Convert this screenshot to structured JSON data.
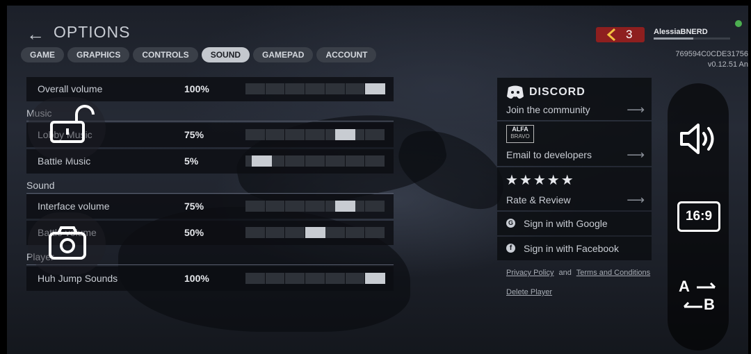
{
  "header": {
    "back_icon": "←",
    "title": "OPTIONS"
  },
  "tabs": [
    {
      "label": "GAME",
      "active": false
    },
    {
      "label": "GRAPHICS",
      "active": false
    },
    {
      "label": "CONTROLS",
      "active": false
    },
    {
      "label": "SOUND",
      "active": true
    },
    {
      "label": "GAMEPAD",
      "active": false
    },
    {
      "label": "ACCOUNT",
      "active": false
    }
  ],
  "settings": {
    "overall": {
      "label": "Overall volume",
      "value": "100%",
      "level": 1.0
    },
    "music_section": "Music",
    "lobby": {
      "label": "Lobby Music",
      "value": "75%",
      "level": 0.75
    },
    "battle_music": {
      "label": "Battle Music",
      "value": "5%",
      "level": 0.05
    },
    "sound_section": "Sound",
    "interface": {
      "label": "Interface volume",
      "value": "75%",
      "level": 0.75
    },
    "battle_volume": {
      "label": "Battle volume",
      "value": "50%",
      "level": 0.5
    },
    "player_section": "Player",
    "huh": {
      "label": "Huh Jump Sounds",
      "value": "100%",
      "level": 1.0
    }
  },
  "player": {
    "badge_number": "3",
    "name": "AlessiaBNERD",
    "id": "769594C0CDE31756",
    "version": "v0.12.51 An",
    "status_color": "#4caf50"
  },
  "community": {
    "discord_logo": "DISCORD",
    "discord_text": "Join the community",
    "alfa_logo_top": "ALFA",
    "alfa_logo_bottom": "BRAVO",
    "email_text": "Email to developers",
    "stars": "★★★★★",
    "rate_text": "Rate & Review",
    "google_text": "Sign in with Google",
    "facebook_text": "Sign in with Facebook",
    "arrow": "⟶"
  },
  "legal": {
    "privacy": "Privacy Policy",
    "and": "and",
    "terms": "Terms and Conditions",
    "delete": "Delete Player"
  },
  "side_controls": {
    "aspect_label": "16:9",
    "translate_a": "A",
    "translate_b": "B"
  },
  "colors": {
    "accent_red": "#8e1f1f",
    "badge_chevron": "#f3c241"
  }
}
